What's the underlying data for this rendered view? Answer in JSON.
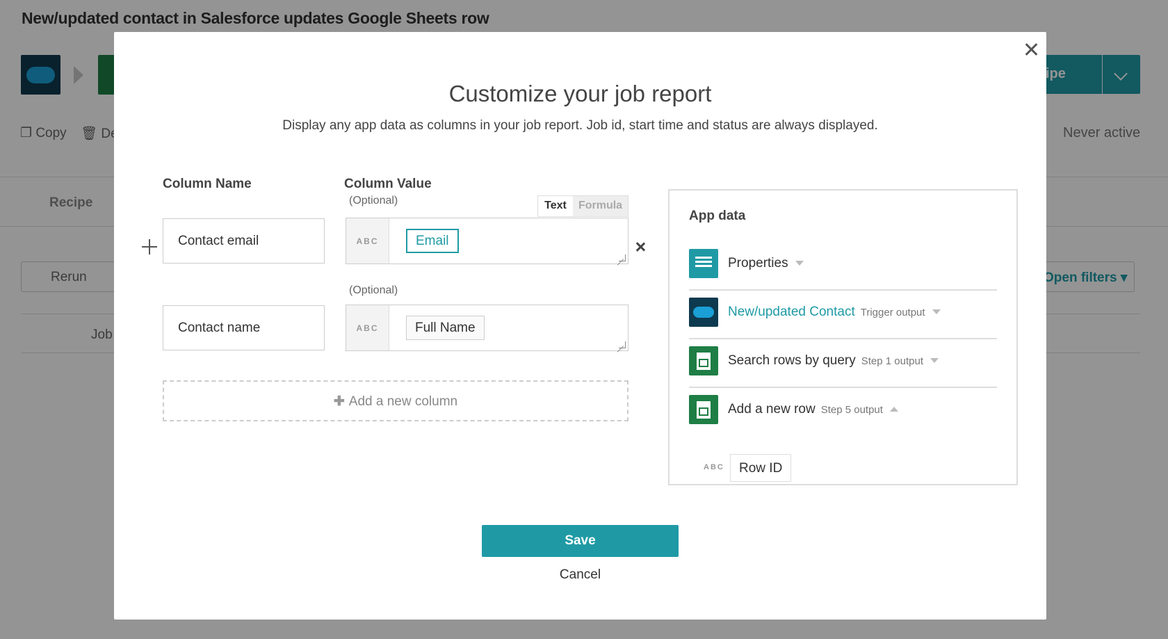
{
  "background": {
    "page_title": "New/updated contact in Salesforce updates Google Sheets row",
    "copy_label": "Copy",
    "delete_label": "Del",
    "recipe_tab": "Recipe",
    "rerun_label": "Rerun",
    "job_label": "Job",
    "recipe_button_partial": "ipe",
    "status": "Never active",
    "open_filters": "Open filters ▾",
    "salesforce_logo_text": "salesforce"
  },
  "modal": {
    "title": "Customize your job report",
    "subtitle": "Display any app data as columns in your job report. Job id, start time and status are always displayed.",
    "column_name_header": "Column Name",
    "column_value_header": "Column Value",
    "optional_label": "(Optional)",
    "toggle": {
      "text": "Text",
      "formula": "Formula"
    },
    "abc_label": "ABC",
    "columns": [
      {
        "name": "Contact email",
        "value_pill": "Email"
      },
      {
        "name": "Contact name",
        "value_pill": "Full Name"
      }
    ],
    "add_column_label": "Add a new column",
    "app_data": {
      "title": "App data",
      "items": [
        {
          "label": "Properties",
          "sub": ""
        },
        {
          "label": "New/updated Contact",
          "sub": "Trigger output"
        },
        {
          "label": "Search rows by query",
          "sub": "Step 1 output"
        },
        {
          "label": "Add a new row",
          "sub": "Step 5 output"
        }
      ],
      "field_pill": "Row ID",
      "field_abc": "ABC"
    },
    "save_label": "Save",
    "cancel_label": "Cancel"
  },
  "colors": {
    "accent": "#1f9aa5",
    "salesforce_navy": "#0e3a4f",
    "sheets_green": "#1e7e45"
  }
}
